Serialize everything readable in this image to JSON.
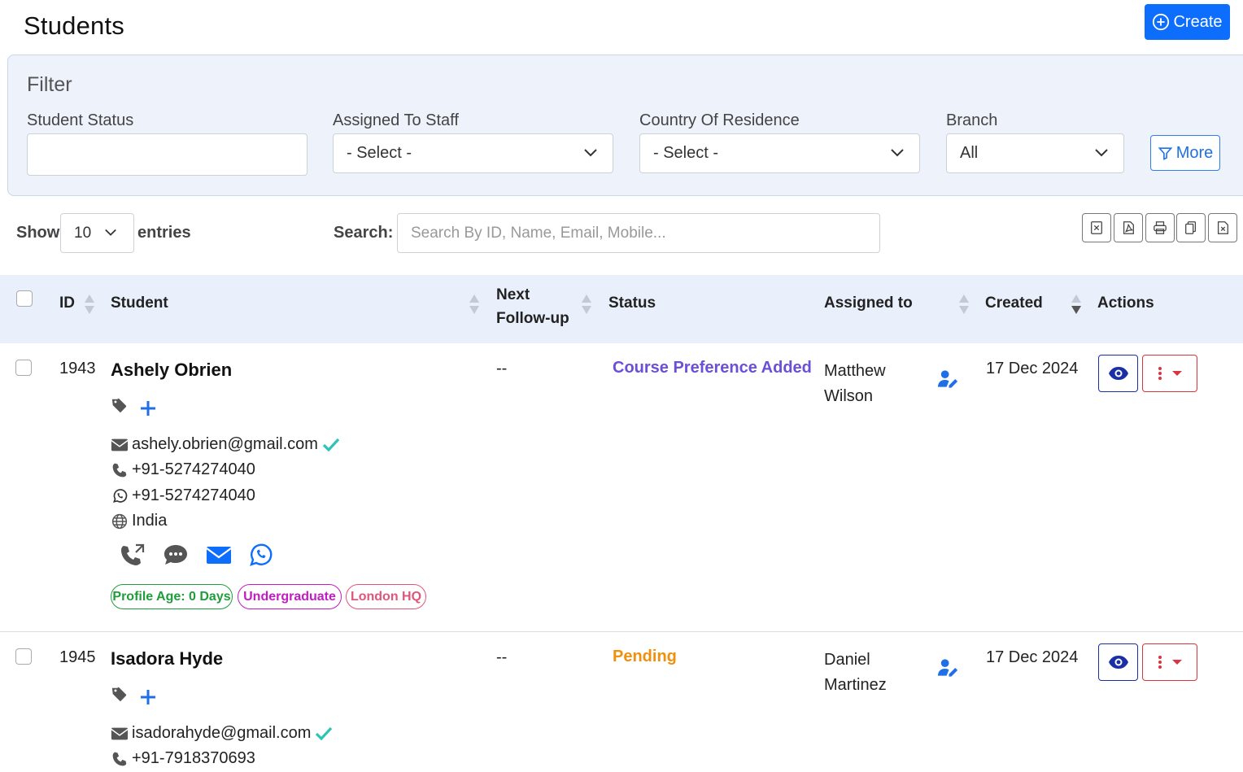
{
  "page": {
    "title": "Students",
    "create_label": "Create"
  },
  "filter": {
    "title": "Filter",
    "student_status": {
      "label": "Student Status",
      "value": ""
    },
    "assigned_to_staff": {
      "label": "Assigned To Staff",
      "value": "- Select -"
    },
    "country_of_residence": {
      "label": "Country Of Residence",
      "value": "- Select -"
    },
    "branch": {
      "label": "Branch",
      "value": "All"
    },
    "more_label": "More"
  },
  "table_controls": {
    "show_label": "Show",
    "entries_value": "10",
    "entries_label": "entries",
    "search_label": "Search:",
    "search_placeholder": "Search By ID, Name, Email, Mobile..."
  },
  "columns": {
    "id": "ID",
    "student": "Student",
    "next_followup_1": "Next",
    "next_followup_2": "Follow-up",
    "status": "Status",
    "assigned_to": "Assigned to",
    "created": "Created",
    "actions": "Actions"
  },
  "rows": [
    {
      "id": "1943",
      "name": "Ashely Obrien",
      "email": "ashely.obrien@gmail.com",
      "phone": "+91-5274274040",
      "whatsapp": "+91-5274274040",
      "country": "India",
      "next_followup": "--",
      "status": "Course Preference Added",
      "status_color": "#6b4fd8",
      "assigned_first": "Matthew",
      "assigned_last": "Wilson",
      "created": "17 Dec 2024",
      "badges": {
        "age": "Profile Age: 0 Days",
        "level": "Undergraduate",
        "branch": "London HQ"
      }
    },
    {
      "id": "1945",
      "name": "Isadora Hyde",
      "email": "isadorahyde@gmail.com",
      "phone": "+91-7918370693",
      "next_followup": "--",
      "status": "Pending",
      "status_color": "#f0900f",
      "assigned_first": "Daniel",
      "assigned_last": "Martinez",
      "created": "17 Dec 2024"
    }
  ],
  "colors": {
    "primary": "#0d6efd",
    "verified": "#2bc4b6",
    "badge_green": "#1f9d3a",
    "badge_magenta": "#c21bc2",
    "badge_pink": "#e0557a"
  }
}
